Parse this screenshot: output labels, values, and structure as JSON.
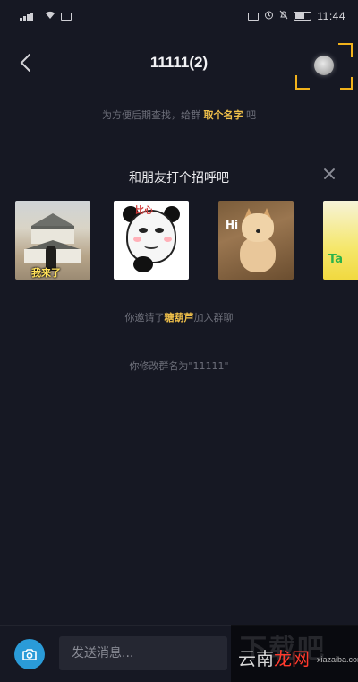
{
  "status_bar": {
    "time": "11:44",
    "icons": [
      "signal-icon",
      "wifi-icon",
      "message-icon",
      "nfc-icon",
      "alarm-icon",
      "mute-icon",
      "battery-icon"
    ],
    "battery": "50"
  },
  "header": {
    "title": "11111(2)",
    "back_icon": "chevron-left-icon",
    "avatar_icon": "group-avatar-icon"
  },
  "name_hint": {
    "prefix": "为方便后期查找，给群",
    "link": "取个名字",
    "suffix": "吧"
  },
  "greeting": {
    "title": "和朋友打个招呼吧",
    "close_icon": "close-icon"
  },
  "stickers": [
    {
      "caption": "我来了",
      "icon": "castle-sticker"
    },
    {
      "caption": "比心",
      "icon": "panda-heart-sticker"
    },
    {
      "caption": "Hi",
      "icon": "shiba-dog-sticker"
    },
    {
      "caption": "Ta",
      "icon": "yellow-sticker"
    }
  ],
  "system_messages": {
    "invite_prefix": "你邀请了",
    "invite_name": "糖葫芦",
    "invite_suffix": "加入群聊",
    "rename": "你修改群名为\"11111\""
  },
  "input_bar": {
    "camera_icon": "camera-icon",
    "placeholder": "发送消息..."
  },
  "watermark": {
    "top": "下载吧",
    "main_part1": "云南",
    "main_part2": "龙网",
    "sub": "xiazaiba.com"
  },
  "colors": {
    "background": "#161823",
    "highlight": "#f0c04a",
    "focus_frame": "#f2b21b",
    "camera_button": "#2a9bd8"
  }
}
